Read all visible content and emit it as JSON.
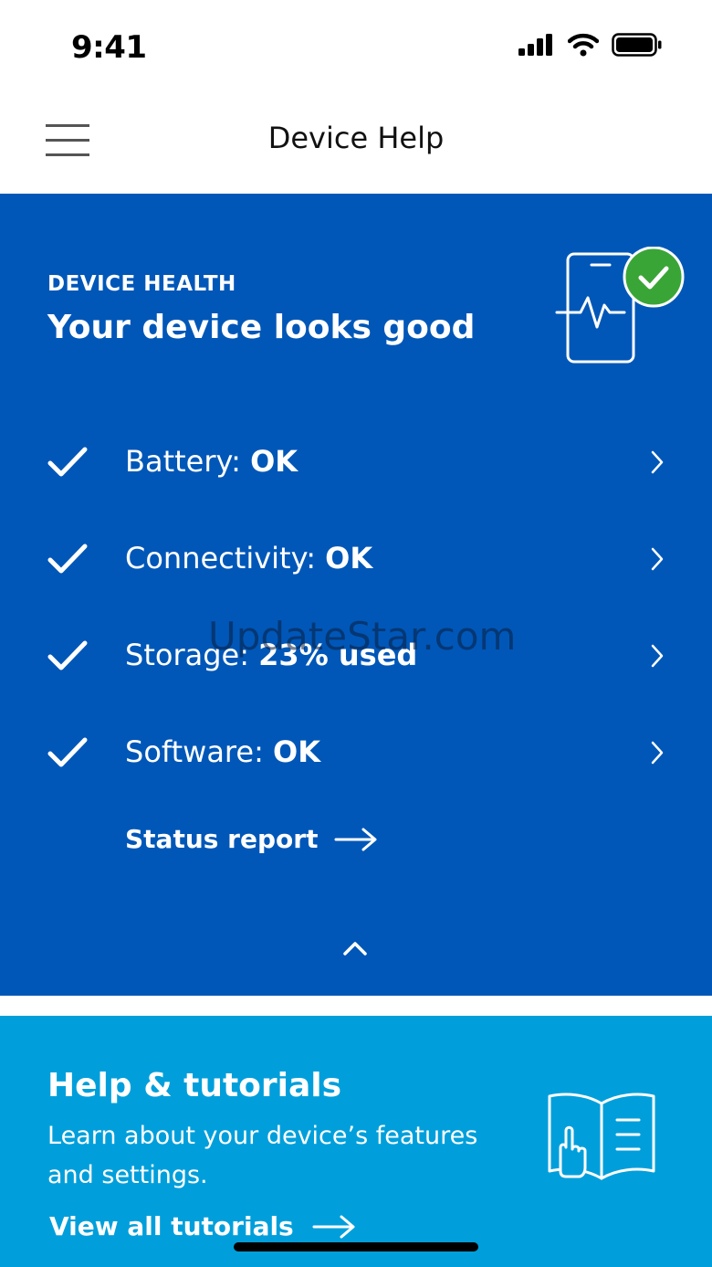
{
  "status_bar": {
    "time": "9:41",
    "icons": [
      "cellular-signal-icon",
      "wifi-icon",
      "battery-icon"
    ]
  },
  "header": {
    "title": "Device Help",
    "menu_icon": "hamburger-menu-icon"
  },
  "device_health": {
    "kicker": "DEVICE HEALTH",
    "title": "Your device looks good",
    "illustration": "phone-heartbeat-check-icon",
    "background_color": "#0057b8",
    "check_badge_color": "#3aa537",
    "rows": [
      {
        "label": "Battery: ",
        "value": "OK"
      },
      {
        "label": "Connectivity: ",
        "value": "OK"
      },
      {
        "label": "Storage: ",
        "value": "23% used"
      },
      {
        "label": "Software: ",
        "value": "OK"
      }
    ],
    "status_link": "Status report"
  },
  "watermark": "UpdateStar.com",
  "tutorials": {
    "title": "Help & tutorials",
    "description": "Learn about your device’s features and settings.",
    "link": "View all tutorials",
    "illustration": "book-hand-icon",
    "background_color": "#009fdb"
  }
}
